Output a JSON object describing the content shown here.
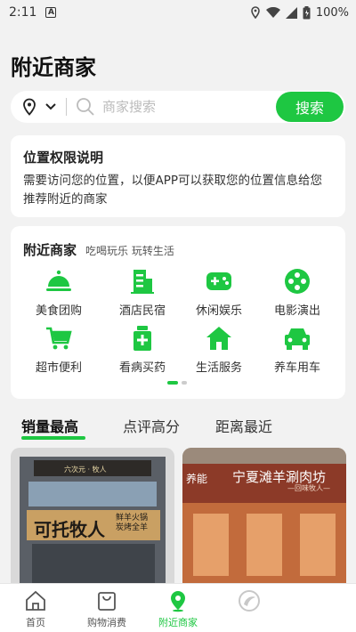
{
  "status_bar": {
    "time": "2:11",
    "notif_letter": "A",
    "battery": "100%"
  },
  "header": {
    "title": "附近商家"
  },
  "search": {
    "placeholder": "商家搜索",
    "button_label": "搜索"
  },
  "permission_card": {
    "title": "位置权限说明",
    "text": "需要访问您的位置，以便APP可以获取您的位置信息给您推荐附近的商家"
  },
  "categories_card": {
    "title": "附近商家",
    "subtitle": "吃喝玩乐 玩转生活",
    "items": [
      {
        "label": "美食团购",
        "icon": "food-cloche-icon"
      },
      {
        "label": "酒店民宿",
        "icon": "hotel-building-icon"
      },
      {
        "label": "休闲娱乐",
        "icon": "gamepad-icon"
      },
      {
        "label": "电影演出",
        "icon": "film-reel-icon"
      },
      {
        "label": "超市便利",
        "icon": "shopping-cart-icon"
      },
      {
        "label": "看病买药",
        "icon": "medicine-bottle-icon"
      },
      {
        "label": "生活服务",
        "icon": "home-icon"
      },
      {
        "label": "养车用车",
        "icon": "car-icon"
      }
    ],
    "page_indicator": {
      "pages": 2,
      "current": 1
    }
  },
  "sort_tabs": [
    {
      "label": "销量最高",
      "active": true
    },
    {
      "label": "点评高分",
      "active": false
    },
    {
      "label": "距离最近",
      "active": false
    }
  ],
  "shops": [
    {
      "top_sign": "六次元 · 牧人",
      "name": "可托牧人",
      "tagline_1": "鲜羊火锅",
      "tagline_2": "炭烤全羊"
    },
    {
      "logo_text": "养能",
      "name": "宁夏滩羊涮肉坊",
      "tagline": "—回味牧人—"
    }
  ],
  "bottom_nav": [
    {
      "label": "首页",
      "icon": "home-outline-icon",
      "active": false
    },
    {
      "label": "购物消费",
      "icon": "shopping-bag-icon",
      "active": false
    },
    {
      "label": "附近商家",
      "icon": "location-pin-icon",
      "active": true
    },
    {
      "label": "",
      "icon": "app-logo-icon",
      "active": false
    }
  ],
  "colors": {
    "accent": "#1ec742",
    "background": "#f2f2f2",
    "card": "#ffffff"
  }
}
